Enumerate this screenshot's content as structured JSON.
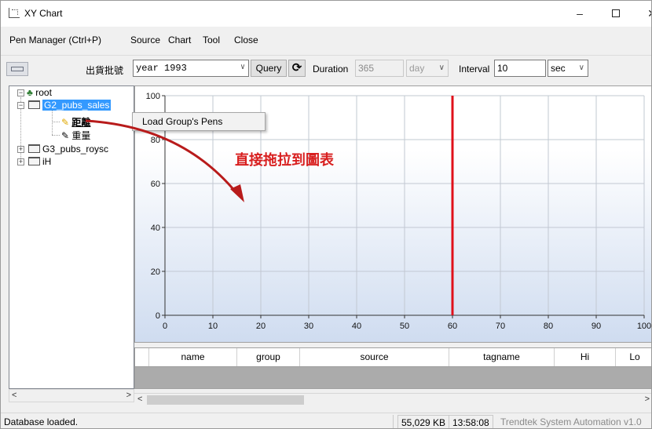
{
  "window": {
    "title": "XY Chart",
    "minimize": "–",
    "close": "✕"
  },
  "menubar": {
    "items": [
      "Pen Manager (Ctrl+P)",
      "Source",
      "Chart",
      "Tool",
      "Close"
    ]
  },
  "toolbar": {
    "batch_label": "出貨批號",
    "batch_value": "year 1993",
    "query_label": "Query",
    "refresh_glyph": "⟳",
    "duration_label": "Duration",
    "duration_value": "365",
    "duration_unit": "day",
    "interval_label": "Interval",
    "interval_value": "10",
    "interval_unit": "sec"
  },
  "tree": {
    "root": "root",
    "groups": [
      "G2_pubs_sales",
      "G3_pubs_roysc",
      "iH"
    ],
    "pens": [
      "距離",
      "重量"
    ]
  },
  "context_menu": {
    "item": "Load Group's Pens"
  },
  "annotation": {
    "text": "直接拖拉到圖表"
  },
  "chart_data": {
    "type": "line",
    "x_ticks": [
      0,
      10,
      20,
      30,
      40,
      50,
      60,
      70,
      80,
      90,
      100
    ],
    "y_ticks": [
      0,
      20,
      40,
      60,
      80,
      100
    ],
    "xlim": [
      0,
      100
    ],
    "ylim": [
      0,
      100
    ],
    "grid": true,
    "cursor_x": 60,
    "cursor_color": "#e0101a",
    "series": []
  },
  "grid": {
    "columns": [
      "name",
      "group",
      "source",
      "tagname",
      "Hi",
      "Lo"
    ]
  },
  "statusbar": {
    "message": "Database loaded.",
    "memory": "55,029 KB",
    "time": "13:58:08",
    "company": "Trendtek System Automation v1.0"
  },
  "scroll": {
    "left": "<",
    "right": ">"
  }
}
